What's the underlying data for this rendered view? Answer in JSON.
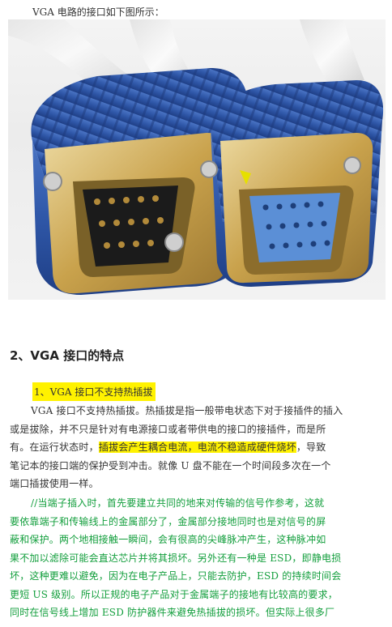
{
  "intro": "VGA 电路的接口如下图所示：",
  "heading": "2、VGA 接口的特点",
  "sub_heading": "1、VGA 接口不支持热插拔",
  "para1": {
    "l1": "VGA 接口不支持热插拔。热插拔是指一般带电状态下对于接插件的插入",
    "l2": "或是拔除，并不只是针对有电源接口或者带供电的接口的接插件，而是所",
    "l3a": "有。在运行状态时，",
    "l3b": "插拔会产生耦合电流，电流不稳造成硬件烧坏",
    "l3c": "，导致",
    "l4": "笔记本的接口端的保护受到冲击。就像 U 盘不能在一个时间段多次在一个",
    "l5": "端口插拔使用一样。"
  },
  "para2": {
    "l1": "//当端子插入时，首先要建立共同的地来对传输的信号作参考，这就",
    "l2": "要依靠端子和传输线上的金属部分了，金属部分接地同时也是对信号的屏",
    "l3": "蔽和保护。两个地相接触一瞬间，会有很高的尖峰脉冲产生，这种脉冲如",
    "l4": "果不加以滤除可能会直达芯片并将其损坏。另外还有一种是 ESD，即静电损",
    "l5": "坏，这种更难以避免，因为在电子产品上，只能去防护，ESD 的持续时间会",
    "l6": "更短 US 级别。所以正规的电子产品对于金属端子的接地有比较高的要求，",
    "l7": "同时在信号线上增加 ESD 防护器件来避免热插拔的损坏。但实际上很多厂"
  },
  "colors": {
    "highlight": "#fff200",
    "green_text": "#129e3c",
    "connector_blue": "#2f57a8",
    "metal_gold": "#c9a24c"
  }
}
